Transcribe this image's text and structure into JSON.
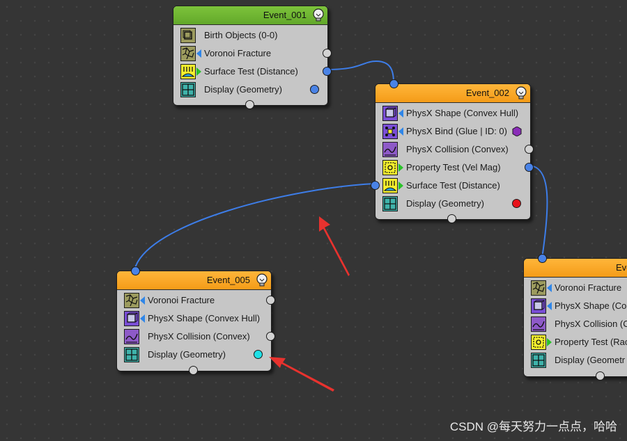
{
  "nodes": {
    "event_001": {
      "title": "Event_001",
      "header_color": "#6cb22f",
      "operators": [
        {
          "label": "Birth Objects (0-0)",
          "icon": "birth-objects-icon"
        },
        {
          "label": "Voronoi Fracture",
          "icon": "voronoi-fracture-icon"
        },
        {
          "label": "Surface Test (Distance)",
          "icon": "surface-test-icon"
        },
        {
          "label": "Display (Geometry)",
          "icon": "display-geometry-icon"
        }
      ]
    },
    "event_002": {
      "title": "Event_002",
      "header_color": "#f7a11f",
      "operators": [
        {
          "label": "PhysX Shape (Convex Hull)",
          "icon": "physx-shape-icon"
        },
        {
          "label": "PhysX Bind (Glue | ID: 0)",
          "icon": "physx-bind-icon"
        },
        {
          "label": "PhysX Collision (Convex)",
          "icon": "physx-collision-icon"
        },
        {
          "label": "Property Test (Vel Mag)",
          "icon": "property-test-icon"
        },
        {
          "label": "Surface Test (Distance)",
          "icon": "surface-test-icon"
        },
        {
          "label": "Display (Geometry)",
          "icon": "display-geometry-icon"
        }
      ]
    },
    "event_005": {
      "title": "Event_005",
      "header_color": "#f7a11f",
      "operators": [
        {
          "label": "Voronoi Fracture",
          "icon": "voronoi-fracture-icon"
        },
        {
          "label": "PhysX Shape (Convex Hull)",
          "icon": "physx-shape-icon"
        },
        {
          "label": "PhysX Collision (Convex)",
          "icon": "physx-collision-icon"
        },
        {
          "label": "Display (Geometry)",
          "icon": "display-geometry-icon"
        }
      ]
    },
    "event_right": {
      "title": "Eve",
      "header_color": "#f7a11f",
      "operators": [
        {
          "label": "Voronoi Fracture",
          "icon": "voronoi-fracture-icon"
        },
        {
          "label": "PhysX Shape (Cor",
          "icon": "physx-shape-icon"
        },
        {
          "label": "PhysX Collision (C",
          "icon": "physx-collision-icon"
        },
        {
          "label": "Property Test (Rac",
          "icon": "property-test-icon"
        },
        {
          "label": "Display (Geometr",
          "icon": "display-geometry-icon"
        }
      ]
    }
  },
  "port_colors": {
    "gray": "#d2d2d2",
    "blue": "#4a83e6",
    "cyan": "#1fe0e6",
    "red": "#e8121a",
    "purple": "#8a2db8"
  },
  "wire_color": "#3d7de8",
  "annotation_color": "#e8322e",
  "watermark": "CSDN @每天努力一点点，哈哈"
}
